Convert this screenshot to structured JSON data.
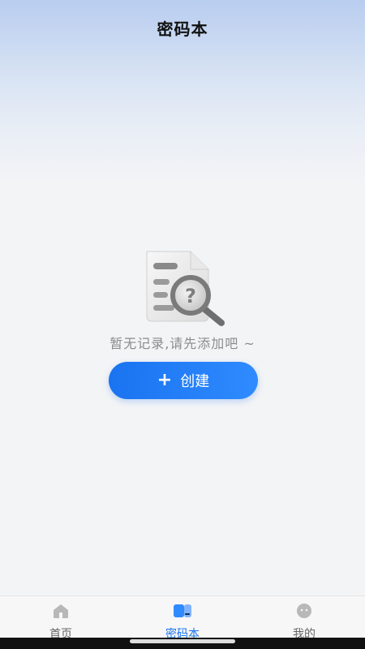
{
  "header": {
    "title": "密码本"
  },
  "empty_state": {
    "icon": "document-search-icon",
    "message": "暂无记录,请先添加吧 ~",
    "button": {
      "icon": "plus-icon",
      "label": "创建"
    }
  },
  "tabbar": {
    "items": [
      {
        "label": "首页",
        "icon": "home-icon",
        "active": false
      },
      {
        "label": "密码本",
        "icon": "book-icon",
        "active": true
      },
      {
        "label": "我的",
        "icon": "face-icon",
        "active": false
      }
    ]
  },
  "colors": {
    "accent": "#1a73f0",
    "text_muted": "#8c8c8c",
    "background": "#f3f4f6"
  }
}
